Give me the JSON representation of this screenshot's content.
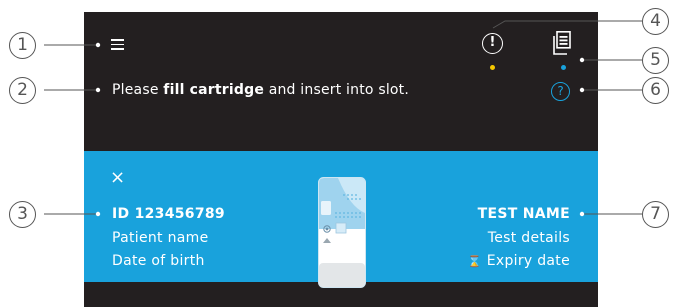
{
  "header": {
    "menu_icon": "hamburger-menu-icon",
    "alert_icon": "exclamation-circle-icon",
    "alert_symbol": "!",
    "documents_icon": "document-list-icon",
    "help_icon": "question-circle-icon",
    "help_symbol": "?"
  },
  "instruction": {
    "prefix": "Please ",
    "emphasis": "fill cartridge",
    "suffix": " and insert into slot."
  },
  "patient": {
    "close_symbol": "×",
    "id": "ID 123456789",
    "name": "Patient name",
    "dob": "Date of birth"
  },
  "test": {
    "name": "TEST NAME",
    "details": "Test details",
    "expiry_icon": "hourglass-icon",
    "expiry_symbol": "⌛",
    "expiry": "Expiry date"
  },
  "callouts": [
    "1",
    "2",
    "3",
    "4",
    "5",
    "6",
    "7"
  ],
  "colors": {
    "screen_bg": "#231f20",
    "accent_blue": "#19a2dc",
    "status_yellow": "#f5c800",
    "status_blue": "#19a2dc",
    "text": "#ffffff",
    "callout_line": "#555555"
  }
}
